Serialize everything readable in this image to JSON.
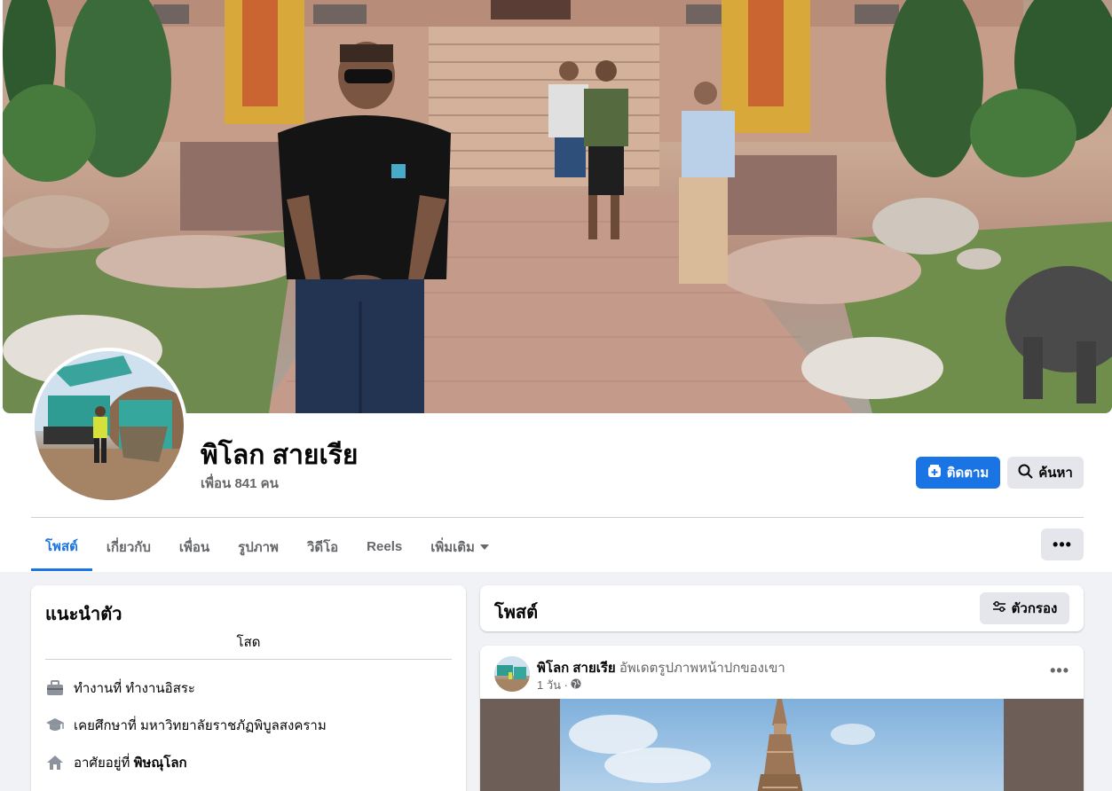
{
  "profile": {
    "name": "พิโลก สายเรีย",
    "friends": "เพื่อน 841 คน",
    "follow_label": "ติดตาม",
    "search_label": "ค้นหา"
  },
  "tabs": [
    {
      "label": "โพสต์",
      "active": true
    },
    {
      "label": "เกี่ยวกับ",
      "active": false
    },
    {
      "label": "เพื่อน",
      "active": false
    },
    {
      "label": "รูปภาพ",
      "active": false
    },
    {
      "label": "วิดีโอ",
      "active": false
    },
    {
      "label": "Reels",
      "active": false
    },
    {
      "label": "เพิ่มเติม",
      "active": false
    }
  ],
  "intro": {
    "title": "แนะนำตัว",
    "bio": "โสด",
    "work_prefix": "ทำงานที่",
    "work_value": "ทำงานอิสระ",
    "edu_prefix": "เคยศึกษาที่",
    "edu_value": "มหาวิทยาลัยราชภัฏพิบูลสงคราม",
    "home_prefix": "อาศัยอยู่ที่",
    "home_value": "พิษณุโลก"
  },
  "posts": {
    "title": "โพสต์",
    "filter_label": "ตัวกรอง",
    "first": {
      "author": "พิโลก สายเรีย",
      "action": "อัพเดตรูปภาพหน้าปกของเขา",
      "time": "1 วัน ·"
    }
  },
  "colors": {
    "accent": "#1b74e4",
    "background": "#f0f2f5",
    "secondary_text": "#65676b"
  }
}
